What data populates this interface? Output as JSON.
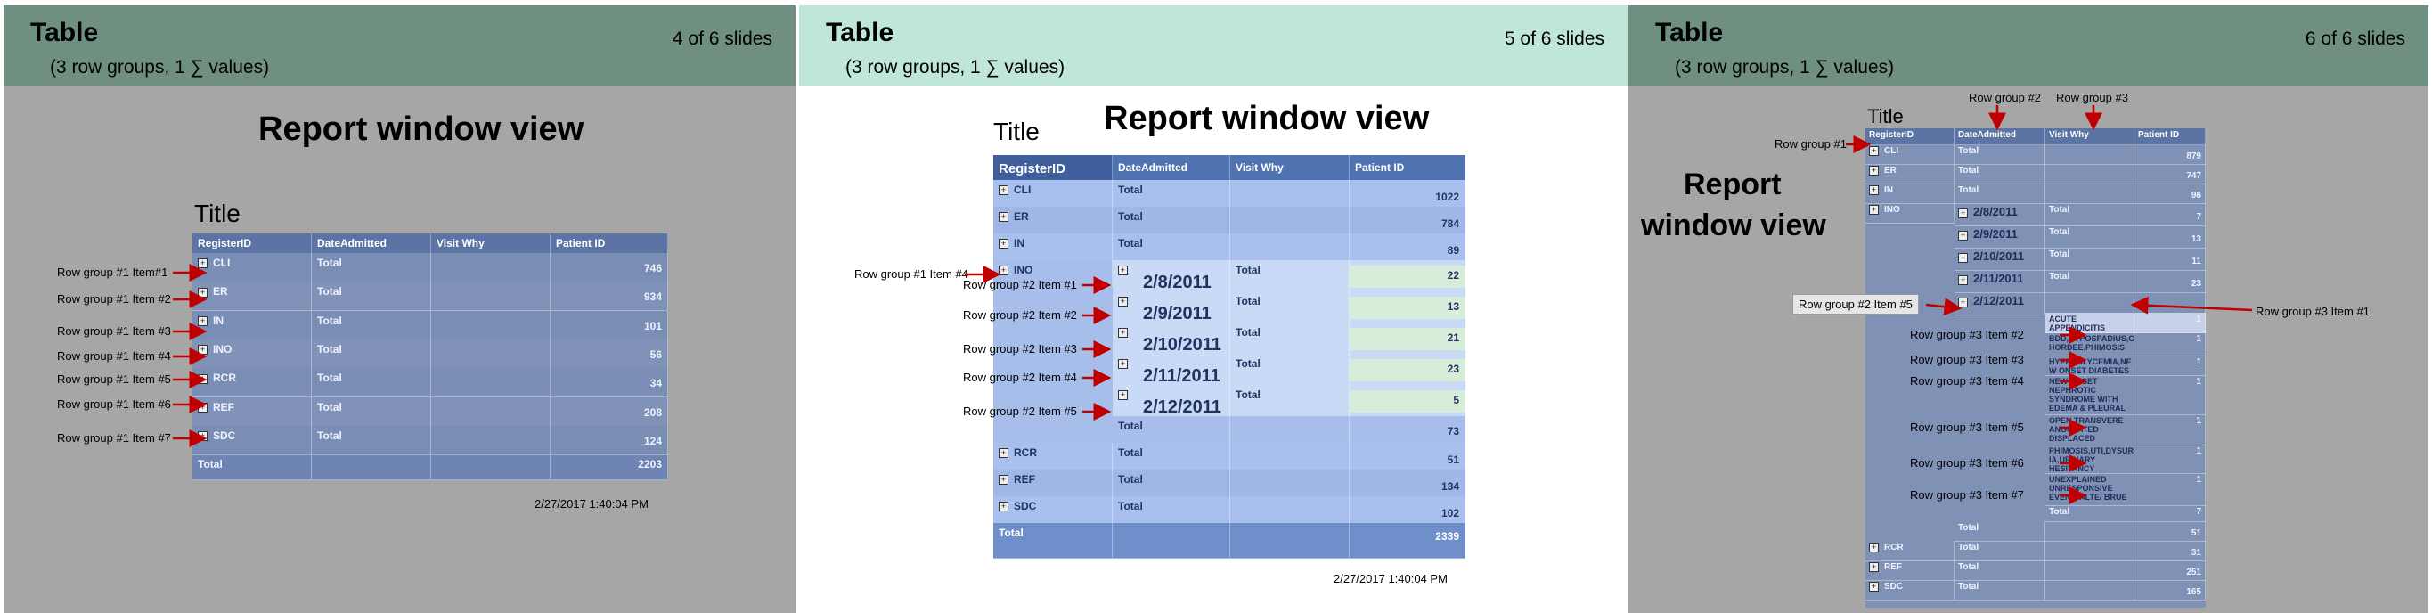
{
  "slides": [
    {
      "title": "Table",
      "subtitle": "(3 row groups, 1 ∑ values)",
      "counter": "4 of 6 slides",
      "view_label": "Report window view",
      "table_title": "Title",
      "columns": [
        "RegisterID",
        "DateAdmitted",
        "Visit Why",
        "Patient ID"
      ],
      "rows": [
        {
          "reg": "CLI",
          "date": "Total",
          "pid": "746"
        },
        {
          "reg": "ER",
          "date": "Total",
          "pid": "934"
        },
        {
          "reg": "IN",
          "date": "Total",
          "pid": "101"
        },
        {
          "reg": "INO",
          "date": "Total",
          "pid": "56"
        },
        {
          "reg": "RCR",
          "date": "Total",
          "pid": "34"
        },
        {
          "reg": "REF",
          "date": "Total",
          "pid": "208"
        },
        {
          "reg": "SDC",
          "date": "Total",
          "pid": "124"
        }
      ],
      "grand_total_label": "Total",
      "grand_total": "2203",
      "timestamp": "2/27/2017  1:40:04 PM",
      "annotations": [
        "Row group #1 Item#1",
        "Row group #1 Item #2",
        "Row group #1 Item #3",
        "Row group #1 Item #4",
        "Row group #1 Item #5",
        "Row group #1 Item #6",
        "Row group #1 Item #7"
      ]
    },
    {
      "title": "Table",
      "subtitle": "(3 row groups, 1 ∑ values)",
      "counter": "5 of 6 slides",
      "view_label": "Report window view",
      "table_title": "Title",
      "columns": [
        "RegisterID",
        "DateAdmitted",
        "Visit Why",
        "Patient ID"
      ],
      "rows_top": [
        {
          "reg": "CLI",
          "date": "Total",
          "pid": "1022"
        },
        {
          "reg": "ER",
          "date": "Total",
          "pid": "784"
        },
        {
          "reg": "IN",
          "date": "Total",
          "pid": "89"
        }
      ],
      "ino_label": "INO",
      "dates": [
        {
          "date": "2/8/2011",
          "visit": "Total",
          "pid": "22"
        },
        {
          "date": "2/9/2011",
          "visit": "Total",
          "pid": "13"
        },
        {
          "date": "2/10/2011",
          "visit": "Total",
          "pid": "21"
        },
        {
          "date": "2/11/2011",
          "visit": "Total",
          "pid": "23"
        },
        {
          "date": "2/12/2011",
          "visit": "Total",
          "pid": "5"
        }
      ],
      "ino_total_label": "Total",
      "ino_total": "73",
      "rows_bottom": [
        {
          "reg": "RCR",
          "date": "Total",
          "pid": "51"
        },
        {
          "reg": "REF",
          "date": "Total",
          "pid": "134"
        },
        {
          "reg": "SDC",
          "date": "Total",
          "pid": "102"
        }
      ],
      "grand_total_label": "Total",
      "grand_total": "2339",
      "timestamp": "2/27/2017  1:40:04 PM",
      "annotations": [
        "Row group #1 Item #4",
        "Row group #2 Item #1",
        "Row group #2 Item #2",
        "Row group #2 Item #3",
        "Row group #2 Item #4",
        "Row group #2 Item #5"
      ]
    },
    {
      "title": "Table",
      "subtitle": "(3 row groups, 1 ∑ values)",
      "counter": "6 of 6 slides",
      "view_label_line1": "Report",
      "view_label_line2": "window view",
      "table_title": "Title",
      "columns": [
        "RegisterID",
        "DateAdmitted",
        "Visit Why",
        "Patient ID"
      ],
      "rows_top": [
        {
          "reg": "CLI",
          "date": "Total",
          "pid": "879"
        },
        {
          "reg": "ER",
          "date": "Total",
          "pid": "747"
        },
        {
          "reg": "IN",
          "date": "Total",
          "pid": "96"
        }
      ],
      "ino_label": "INO",
      "dates": [
        {
          "date": "2/8/2011",
          "visit": "Total",
          "pid": "7"
        },
        {
          "date": "2/9/2011",
          "visit": "Total",
          "pid": "13"
        },
        {
          "date": "2/10/2011",
          "visit": "Total",
          "pid": "11"
        },
        {
          "date": "2/11/2011",
          "visit": "Total",
          "pid": "23"
        },
        {
          "date": "2/12/2011",
          "visit": "",
          "pid": ""
        }
      ],
      "reasons": [
        {
          "text": "ACUTE APPENDICITIS",
          "pid": "1"
        },
        {
          "text": "BDD,HYPOSPADIUS,C HORDEE,PHIMOSIS",
          "pid": "1"
        },
        {
          "text": "HYPERGLYCEMIA,NE W ONSET DIABETES",
          "pid": "1"
        },
        {
          "text": "NEW ONSET NEPHROTIC SYNDROME WITH EDEMA & PLEURAL",
          "pid": "1"
        },
        {
          "text": "OPEN TRANSVERE ANGULATED DISPLACED",
          "pid": "1"
        },
        {
          "text": "PHIMOSIS,UTI,DYSUR IA,URINARY HESITANCY",
          "pid": "1"
        },
        {
          "text": "UNEXPLAINED UNRESPONSIVE EVENT; ALTE/ BRUE",
          "pid": "1"
        }
      ],
      "reason_total_label": "Total",
      "reason_total": "7",
      "ino_total_label": "Total",
      "ino_total": "51",
      "rows_bottom": [
        {
          "reg": "RCR",
          "date": "Total",
          "pid": "31"
        },
        {
          "reg": "REF",
          "date": "Total",
          "pid": "251"
        },
        {
          "reg": "SDC",
          "date": "Total",
          "pid": "165"
        }
      ],
      "annotations": {
        "rg2": "Row group #2",
        "rg3": "Row group #3",
        "rg1": "Row group #1",
        "rg2i5": "Row group #2 Item #5",
        "rg3i1": "Row group #3 Item #1",
        "items": [
          "Row group #3 Item #2",
          "Row group #3 Item #3",
          "Row group #3 Item #4",
          "Row group #3 Item #5",
          "Row group #3 Item #6",
          "Row group #3 Item #7"
        ]
      }
    }
  ],
  "colors": {
    "arrow": "#c00000",
    "header_dark": "#6f8f80",
    "header_light": "#bfe6d6",
    "table_blue": "#8fa8dc",
    "table_header": "#4f72b0"
  }
}
